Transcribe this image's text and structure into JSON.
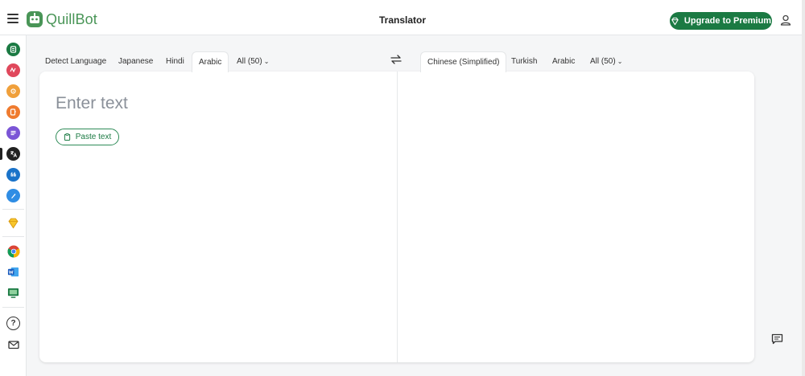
{
  "app": {
    "brand": "QuillBot",
    "title": "Translator",
    "premium_label": "Upgrade to Premium"
  },
  "sidebar": {
    "items": [
      {
        "icon": "paraphraser-icon",
        "color": "#1b7a43"
      },
      {
        "icon": "grammar-checker-icon",
        "color": "#e0485c"
      },
      {
        "icon": "ai-detector-icon",
        "color": "#f0a03b"
      },
      {
        "icon": "plagiarism-checker-icon",
        "color": "#ef7b2f"
      },
      {
        "icon": "summarizer-icon",
        "color": "#7b55d6"
      },
      {
        "icon": "translator-icon",
        "color": "#222222",
        "active": true
      },
      {
        "icon": "citation-generator-icon",
        "color": "#1a73c9"
      },
      {
        "icon": "quillbot-flow-icon",
        "color": "#2f8de4"
      },
      {
        "icon": "premium-diamond-icon",
        "color": "#f2b620"
      },
      {
        "icon": "chrome-extension-icon",
        "color": "#db4437"
      },
      {
        "icon": "word-addin-icon",
        "color": "#2b579a"
      },
      {
        "icon": "desktop-app-icon",
        "color": "#1b7a43"
      },
      {
        "icon": "help-icon",
        "color": "#333333"
      },
      {
        "icon": "mail-icon",
        "color": "#333333"
      }
    ]
  },
  "source_tabs": [
    "Detect Language",
    "Japanese",
    "Hindi",
    "Arabic",
    "All (50)"
  ],
  "source_active": "Arabic",
  "target_tabs": [
    "Chinese (Simplified)",
    "Turkish",
    "Arabic",
    "All (50)"
  ],
  "target_active": "Chinese (Simplified)",
  "editor": {
    "placeholder": "Enter text",
    "value": "",
    "paste_label": "Paste text"
  }
}
